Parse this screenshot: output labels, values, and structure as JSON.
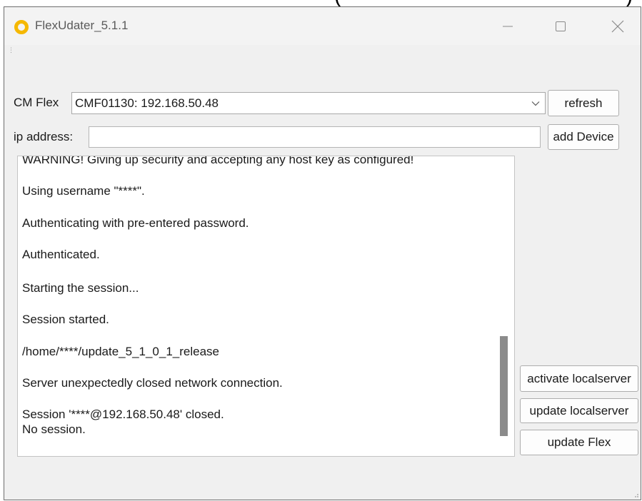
{
  "window": {
    "title": "FlexUdater_5.1.1",
    "top_cropped_text": "(                                             )",
    "icon": "circle-ring-icon",
    "accent_color": "#f5b800"
  },
  "controls": {
    "cm_flex_label": "CM Flex",
    "cm_flex_selected": "CMF01130: 192.168.50.48",
    "ip_label": "ip address:",
    "ip_value": "",
    "refresh_label": "refresh",
    "add_device_label": "add Device"
  },
  "log": {
    "lines": [
      "WARNING! Giving up security and accepting any host key as configured!",
      "Using username \"****\".",
      "Authenticating with pre-entered password.",
      "Authenticated.",
      "Starting the session...",
      "Session started.",
      "/home/****/update_5_1_0_1_release",
      "Server unexpectedly closed network connection.",
      "Session '****@192.168.50.48' closed.",
      "No session."
    ]
  },
  "actions": {
    "activate_localserver": "activate localserver",
    "update_localserver": "update localserver",
    "update_flex": "update Flex"
  }
}
